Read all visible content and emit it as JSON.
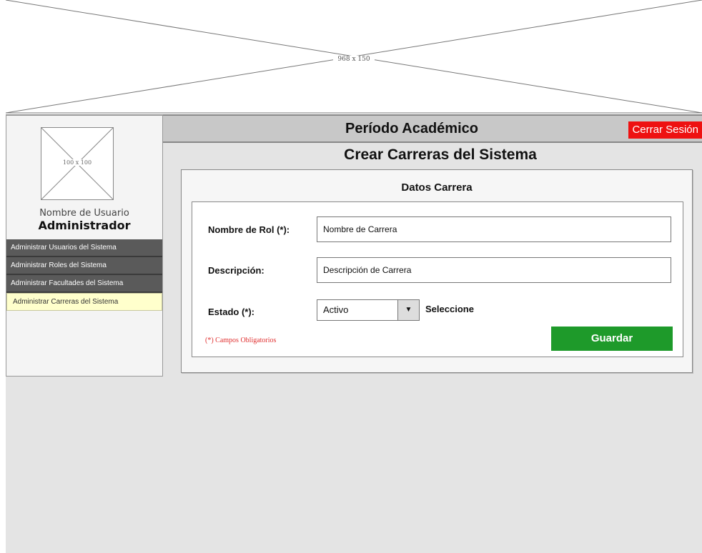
{
  "banner": {
    "placeholder_label": "968 x 150"
  },
  "sidebar": {
    "avatar_placeholder_label": "100 x 100",
    "username": "Nombre de Usuario",
    "role": "Administrador",
    "menu": [
      {
        "label": "Administrar Usuarios del Sistema",
        "active": false
      },
      {
        "label": "Administrar Roles del Sistema",
        "active": false
      },
      {
        "label": "Administrar Facultades del Sistema",
        "active": false
      },
      {
        "label": "Administrar Carreras del Sistema",
        "active": true
      }
    ]
  },
  "header": {
    "title": "Período Académico",
    "logout_label": "Cerrar Sesión"
  },
  "page": {
    "title": "Crear Carreras del Sistema"
  },
  "form": {
    "panel_title": "Datos Carrera",
    "name": {
      "label": "Nombre de Rol (*):",
      "value": "Nombre de Carrera"
    },
    "description": {
      "label": "Descripción:",
      "value": "Descripción de Carrera"
    },
    "status": {
      "label": "Estado (*):",
      "value": "Activo",
      "hint": "Seleccione"
    },
    "required_note": "(*) Campos Obligatorios",
    "save_label": "Guardar"
  },
  "colors": {
    "logout": "#ee1111",
    "save": "#1e9a2a",
    "active_menu": "#ffffcc",
    "menu": "#5a5a5a",
    "required_note": "#e03030"
  }
}
